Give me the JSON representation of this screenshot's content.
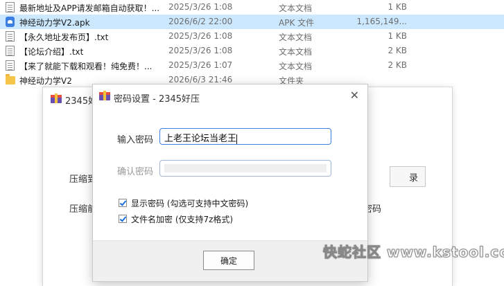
{
  "files": [
    {
      "name": "最新地址及APP请发邮箱自动获取！...",
      "date": "2025/3/26 1:08",
      "type": "文本文档",
      "size": "1 KB",
      "icon": "text-file-icon",
      "selected": false
    },
    {
      "name": "神经动力学V2.apk",
      "date": "2026/6/2 22:00",
      "type": "APK 文件",
      "size": "1,165,149...",
      "icon": "apk-file-icon",
      "selected": true
    },
    {
      "name": "【永久地址发布页】.txt",
      "date": "2025/3/26 1:08",
      "type": "文本文档",
      "size": "1 KB",
      "icon": "text-file-icon",
      "selected": false
    },
    {
      "name": "【论坛介绍】.txt",
      "date": "2025/3/26 1:08",
      "type": "文本文档",
      "size": "2 KB",
      "icon": "text-file-icon",
      "selected": false
    },
    {
      "name": "【来了就能下载和观看！纯免费！...",
      "date": "2025/3/26 1:07",
      "type": "文本文档",
      "size": "2 KB",
      "icon": "text-file-icon",
      "selected": false
    },
    {
      "name": "神经动力学V2",
      "date": "2026/6/3 21:46",
      "type": "文件夹",
      "size": "",
      "icon": "folder-icon",
      "selected": false
    }
  ],
  "back_window": {
    "title": "2345好",
    "label1": "压缩到",
    "label2": "压缩前",
    "side_button": "录",
    "side_label": "密码"
  },
  "dialog": {
    "title": "密码设置 - 2345好压",
    "close": "✕",
    "password_label": "输入密码",
    "password_value": "上老王论坛当老王",
    "confirm_label": "确认密码",
    "confirm_value": "",
    "show_password_label": "显示密码 (勾选可支持中文密码)",
    "show_password_checked": true,
    "encrypt_names_label": "文件名加密 (仅支持7z格式)",
    "encrypt_names_checked": true,
    "ok_label": "确定"
  },
  "watermark": "快蛇社区 www.kstool.cc",
  "colors": {
    "selection": "#cce8ff",
    "accent": "#3c7ee0"
  }
}
